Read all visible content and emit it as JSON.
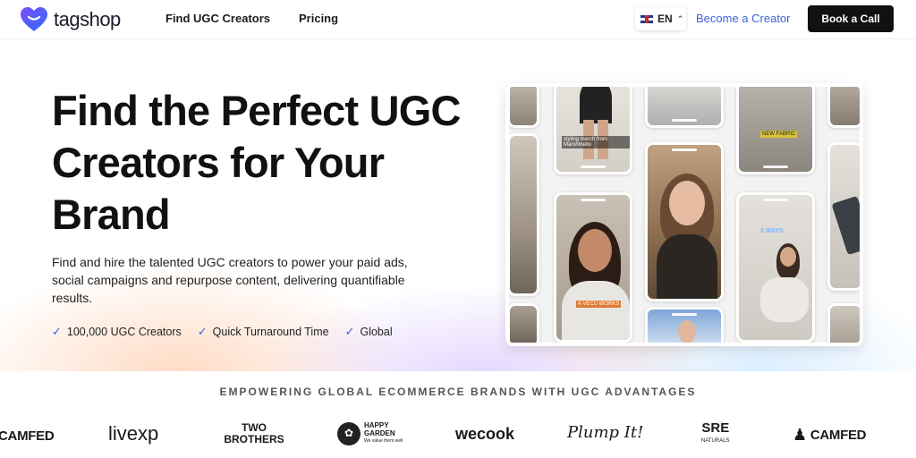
{
  "nav": {
    "logo_text": "tagshop",
    "links": [
      "Find UGC Creators",
      "Pricing"
    ],
    "language": "EN",
    "become_creator": "Become a Creator",
    "book_call": "Book a Call"
  },
  "hero": {
    "headline": "Find the Perfect UGC Creators for Your Brand",
    "subtitle": "Find and hire the talented UGC creators to power your paid ads, social campaigns and repurpose content, delivering quantifiable results.",
    "features": [
      "100,000 UGC Creators",
      "Quick Turnaround Time",
      "Global"
    ]
  },
  "video_grid": {
    "captions": [
      "styling merch from Marshmello",
      "NEW FABRIC",
      "3 WAYS",
      "A VECU WORKS"
    ]
  },
  "brands": {
    "title": "EMPOWERING GLOBAL ECOMMERCE BRANDS WITH UGC ADVANTAGES",
    "items": [
      "CAMFED",
      "livexp",
      "TWO BROTHERS",
      "HAPPY GARDEN",
      "We value them well",
      "wecook",
      "Plump It!",
      "SRE",
      "NATURALS",
      "CAMFED"
    ]
  },
  "colors": {
    "accent": "#3a63d6",
    "cta_bg": "#111111",
    "logo_gradient_start": "#6a4df5",
    "logo_gradient_end": "#2f7bff"
  }
}
